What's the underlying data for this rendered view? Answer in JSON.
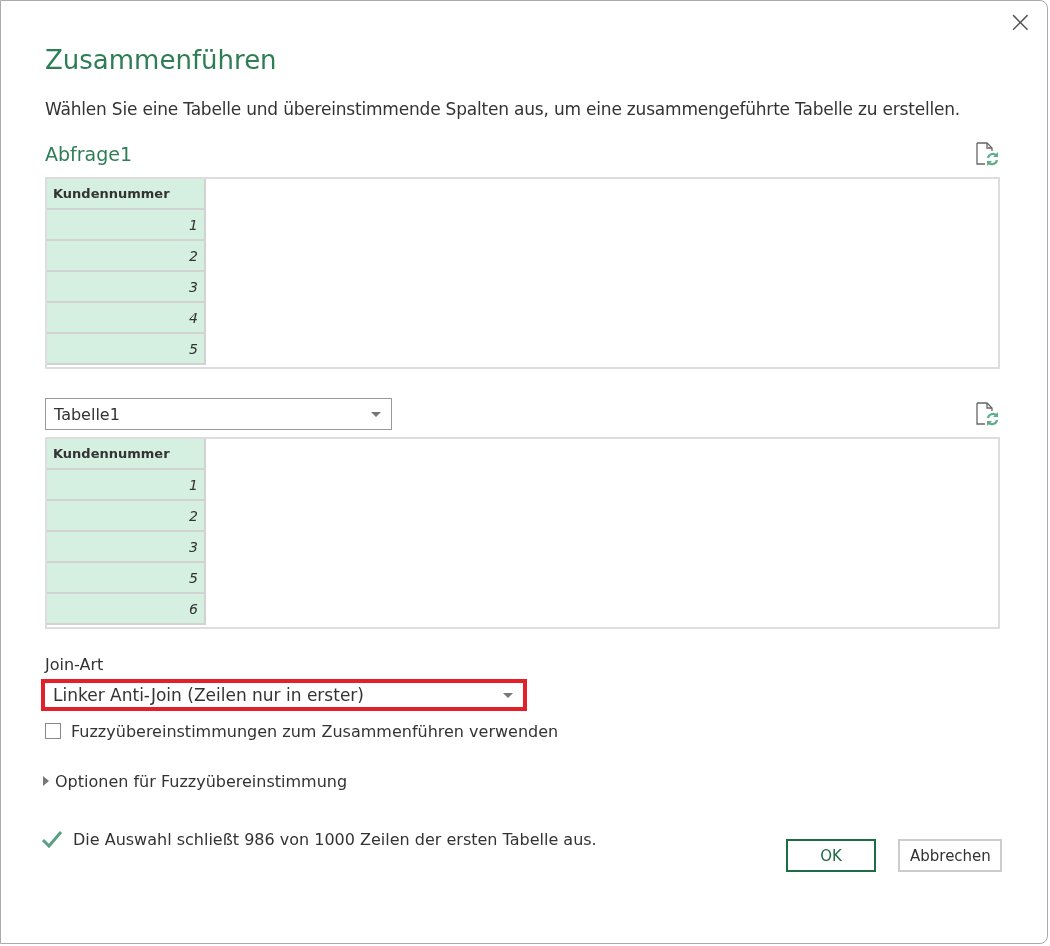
{
  "dialog": {
    "title": "Zusammenführen",
    "close": "×",
    "description": "Wählen Sie eine Tabelle und übereinstimmende Spalten aus, um eine zusammengeführte Tabelle zu erstellen."
  },
  "first_table": {
    "name": "Abfrage1",
    "columns": [
      {
        "label": "Kundennummer",
        "selected": true
      }
    ],
    "rows": [
      [
        "1"
      ],
      [
        "2"
      ],
      [
        "3"
      ],
      [
        "4"
      ],
      [
        "5"
      ]
    ]
  },
  "second_table": {
    "selector": {
      "value": "Tabelle1"
    },
    "columns": [
      {
        "label": "Kundennummer",
        "selected": true
      }
    ],
    "rows": [
      [
        "1"
      ],
      [
        "2"
      ],
      [
        "3"
      ],
      [
        "5"
      ],
      [
        "6"
      ]
    ]
  },
  "join_type": {
    "label": "Join-Art",
    "value": "Linker Anti-Join (Zeilen nur in erster)",
    "highlighted": true
  },
  "fuzzy_checkbox": {
    "label": "Fuzzyübereinstimmungen zum Zusammenführen verwenden",
    "checked": false
  },
  "fuzzy_options": {
    "label": "Optionen für Fuzzyübereinstimmung",
    "expanded": false
  },
  "status": {
    "text": "Die Auswahl schließt 986 von 1000 Zeilen der ersten Tabelle aus.",
    "ok": true
  },
  "buttons": [
    {
      "label": "OK",
      "kind": "primary"
    },
    {
      "label": "Abbrechen",
      "kind": "secondary"
    }
  ]
}
